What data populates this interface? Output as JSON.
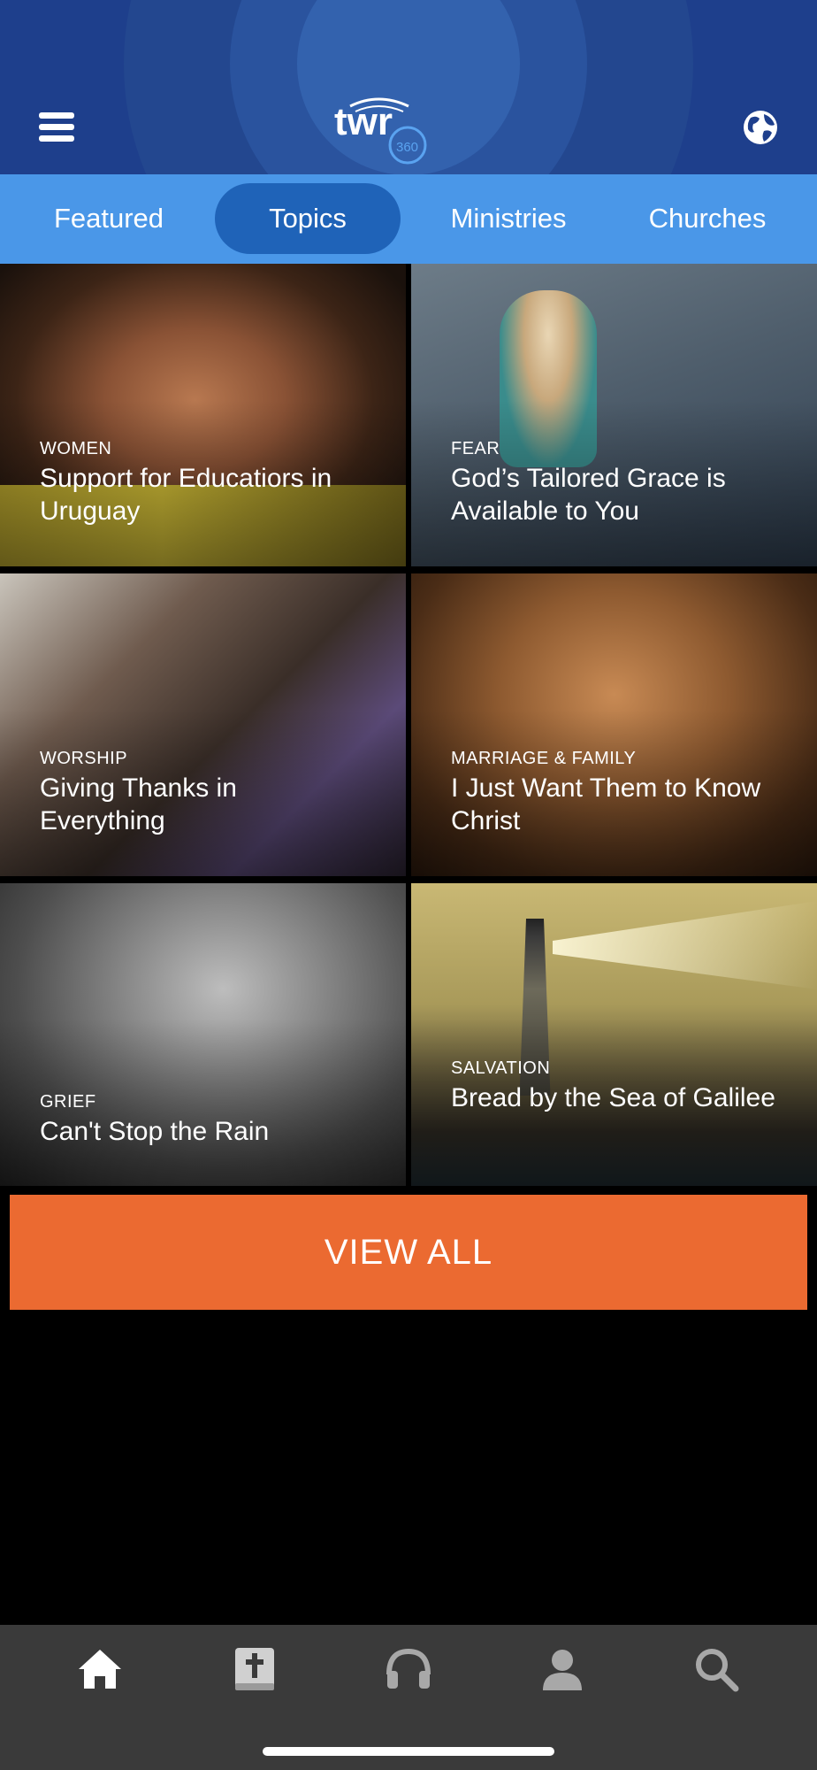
{
  "header": {
    "logo_text": "twr",
    "logo_sub": "360",
    "menu_icon": "hamburger-menu-icon",
    "globe_icon": "globe-icon"
  },
  "tabs": [
    {
      "label": "Featured",
      "active": false
    },
    {
      "label": "Topics",
      "active": true
    },
    {
      "label": "Ministries",
      "active": false
    },
    {
      "label": "Churches",
      "active": false
    }
  ],
  "tiles": [
    {
      "category": "WOMEN",
      "title": "Support for Educatiors in Uruguay"
    },
    {
      "category": "FEAR",
      "title": "God’s Tailored Grace is Available to You"
    },
    {
      "category": "WORSHIP",
      "title": "Giving Thanks in Everything"
    },
    {
      "category": "MARRIAGE & FAMILY",
      "title": "I Just Want Them to Know Christ"
    },
    {
      "category": "GRIEF",
      "title": "Can't Stop the Rain"
    },
    {
      "category": "SALVATION",
      "title": "Bread by the Sea of Galilee"
    }
  ],
  "view_all_label": "VIEW ALL",
  "bottom_nav": [
    {
      "icon": "home-icon"
    },
    {
      "icon": "bible-icon"
    },
    {
      "icon": "headphones-icon"
    },
    {
      "icon": "profile-icon"
    },
    {
      "icon": "search-icon"
    }
  ],
  "colors": {
    "header_bg": "#1e3f8c",
    "tabs_bg": "#4a97e8",
    "active_tab": "#1f63b8",
    "view_all": "#eb6a31",
    "bottom_nav_bg": "#3a3a3a"
  }
}
